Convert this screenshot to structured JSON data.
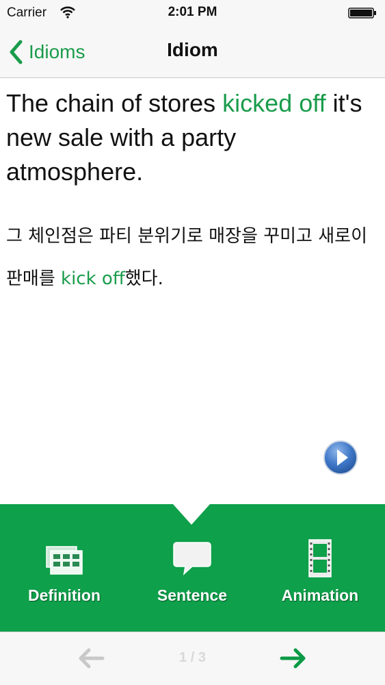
{
  "status_bar": {
    "carrier": "Carrier",
    "time": "2:01 PM",
    "wifi_icon": "wifi-icon",
    "battery_icon": "battery-full-icon"
  },
  "nav": {
    "back_label": "Idioms",
    "title": "Idiom"
  },
  "content": {
    "english": {
      "before": "The chain of stores ",
      "highlight": "kicked off",
      "after": " it's new sale with a party atmosphere."
    },
    "korean": {
      "before": "그 체인점은 파티 분위기로 매장을 꾸미고 새로이 판매를 ",
      "highlight": "kick off",
      "after": "했다."
    },
    "play_icon": "play-icon"
  },
  "tabs": [
    {
      "label": "Definition",
      "icon": "definition-icon"
    },
    {
      "label": "Sentence",
      "icon": "speech-bubble-icon"
    },
    {
      "label": "Animation",
      "icon": "film-strip-icon"
    }
  ],
  "toolbar": {
    "page_indicator": "1 / 3",
    "prev_icon": "arrow-left-icon",
    "next_icon": "arrow-right-icon"
  },
  "colors": {
    "accent_green": "#1a9c4b",
    "tab_panel_green": "#0ea04a",
    "nav_background": "#f7f7f7",
    "disabled_gray": "#c8c8c8"
  }
}
